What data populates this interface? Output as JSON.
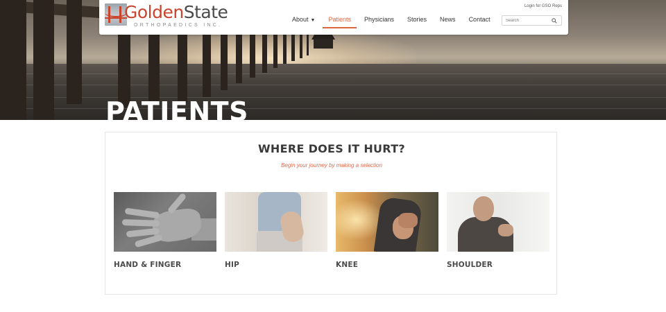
{
  "header": {
    "logo": {
      "name_part1": "Golden",
      "name_part2": "State",
      "subtitle": "ORTHOPAEDICS INC."
    },
    "login_link": "Login for GSO Reps",
    "nav": [
      {
        "label": "About",
        "has_dropdown": true,
        "active": false
      },
      {
        "label": "Patients",
        "active": true
      },
      {
        "label": "Physicians",
        "active": false
      },
      {
        "label": "Stories",
        "active": false
      },
      {
        "label": "News",
        "active": false
      },
      {
        "label": "Contact",
        "active": false
      }
    ],
    "search": {
      "placeholder": "Search",
      "icon": "search-icon"
    }
  },
  "hero": {
    "title": "PATIENTS"
  },
  "main": {
    "title": "WHERE DOES IT HURT?",
    "subtitle": "Begin your journey by making a selection",
    "tiles": [
      {
        "label": "HAND & FINGER"
      },
      {
        "label": "HIP"
      },
      {
        "label": "KNEE"
      },
      {
        "label": "SHOULDER"
      }
    ]
  },
  "colors": {
    "accent": "#e06640",
    "brand_red": "#c8442c",
    "text_dark": "#3a3a3a"
  }
}
